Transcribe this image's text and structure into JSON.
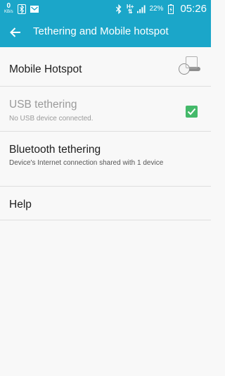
{
  "status_bar": {
    "net_speed_value": "0",
    "net_speed_unit": "KB/s",
    "signal_type": "H+",
    "battery_percent": "22%",
    "time": "05:26"
  },
  "app_bar": {
    "title": "Tethering and Mobile hotspot"
  },
  "items": [
    {
      "title": "Mobile Hotspot",
      "subtitle": "",
      "control": "switch",
      "enabled": true,
      "checked": false
    },
    {
      "title": "USB tethering",
      "subtitle": "No USB device connected.",
      "control": "checkbox",
      "enabled": false,
      "checked": false
    },
    {
      "title": "Bluetooth tethering",
      "subtitle": "Device's Internet connection shared with 1 device",
      "control": "checkbox",
      "enabled": true,
      "checked": true
    },
    {
      "title": "Help",
      "subtitle": "",
      "control": "none",
      "enabled": true,
      "checked": false
    }
  ],
  "colors": {
    "accent": "#1ba6c9",
    "check": "#44b96a",
    "background": "#f8f8f8"
  }
}
